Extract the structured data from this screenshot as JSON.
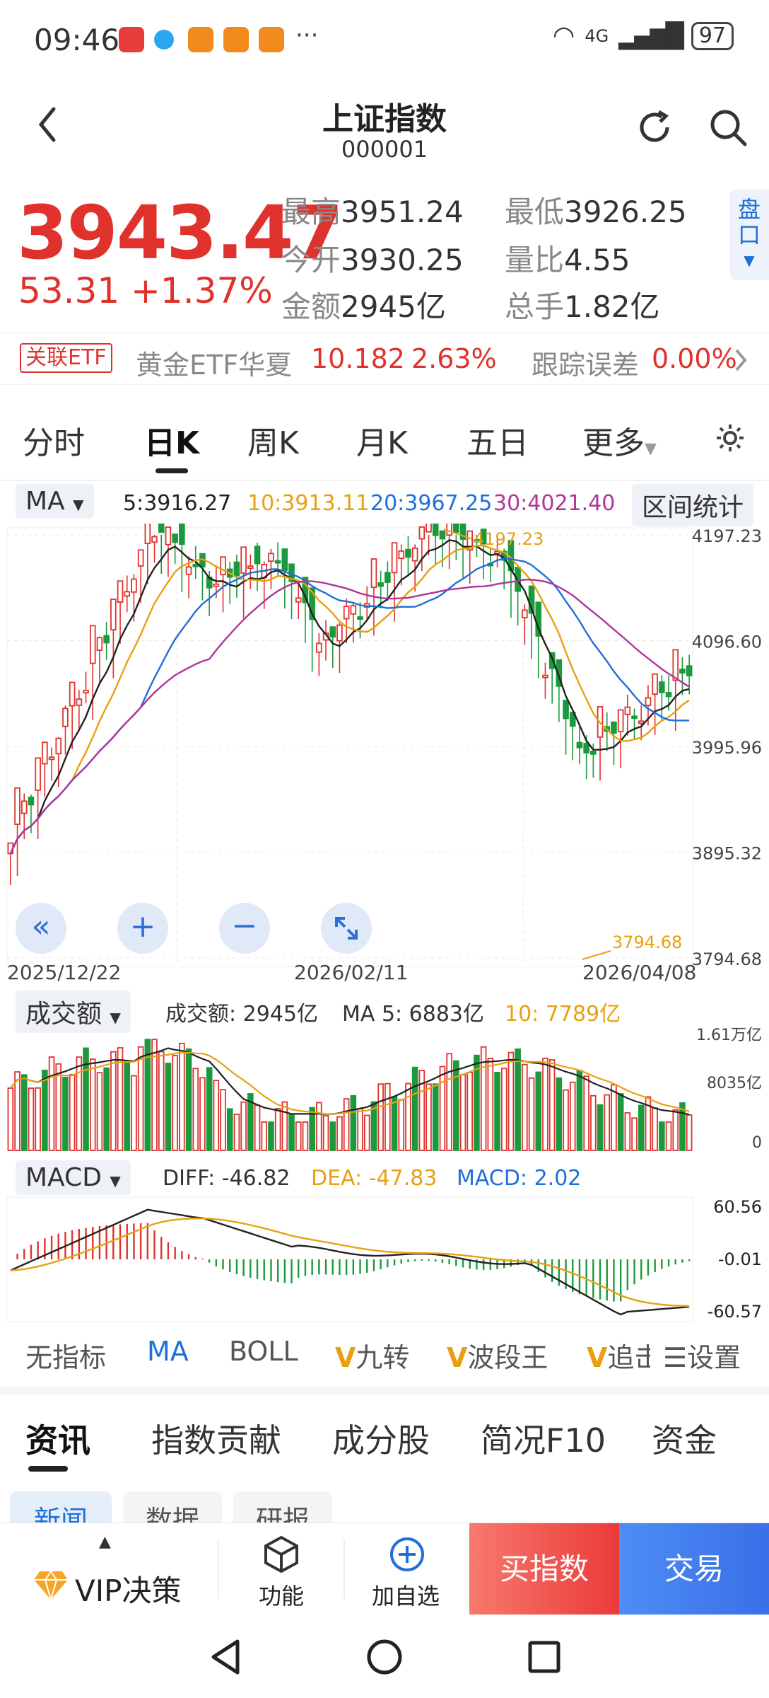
{
  "status_bar": {
    "time": "09:46",
    "ellipsis": "···",
    "network": "4G",
    "battery": "97"
  },
  "header": {
    "title": "上证指数",
    "code": "000001"
  },
  "quote": {
    "price": "3943.47",
    "change": "53.31 +1.37%",
    "high_label": "最高",
    "high": "3951.24",
    "low_label": "最低",
    "low": "3926.25",
    "open_label": "今开",
    "open": "3930.25",
    "ratio_label": "量比",
    "ratio": "4.55",
    "amount_label": "金额",
    "amount": "2945亿",
    "hands_label": "总手",
    "hands": "1.82亿",
    "pankou": "盘口"
  },
  "etf": {
    "tag": "关联ETF",
    "name": "黄金ETF华夏",
    "price": "10.182",
    "change": "2.63%",
    "error_label": "跟踪误差",
    "error": "0.00%"
  },
  "period_tabs": [
    "分时",
    "日K",
    "周K",
    "月K",
    "五日",
    "更多"
  ],
  "ma_row": {
    "selector": "MA",
    "ma5": "5:3916.27",
    "ma10": "10:3913.11",
    "ma20": "20:3967.25",
    "ma30": "30:4021.40",
    "range_stats": "区间统计"
  },
  "kline": {
    "y_ticks": [
      "4197.23",
      "4096.60",
      "3995.96",
      "3895.32",
      "3794.68"
    ],
    "high_marker": "4197.23",
    "low_marker": "3794.68",
    "dates": [
      "2025/12/22",
      "2026/02/11",
      "2026/04/08"
    ]
  },
  "volume": {
    "selector": "成交额",
    "value": "成交额: 2945亿",
    "ma5": "MA 5: 6883亿",
    "ma10": "10: 7789亿",
    "y_ticks": [
      "1.61万亿",
      "8035亿",
      "0"
    ]
  },
  "macd": {
    "selector": "MACD",
    "diff": "DIFF: -46.82",
    "dea": "DEA: -47.83",
    "macd": "MACD: 2.02",
    "y_ticks": [
      "60.56",
      "-0.01",
      "-60.57"
    ]
  },
  "indicator_tabs": [
    "无指标",
    "MA",
    "BOLL",
    "九转",
    "波段王",
    "追击",
    "设置"
  ],
  "news_tabs": [
    "资讯",
    "指数贡献",
    "成分股",
    "简况F10",
    "资金"
  ],
  "sub_tabs": [
    "新闻",
    "数据",
    "研报"
  ],
  "bottom_bar": {
    "vip": "VIP决策",
    "func": "功能",
    "add": "加自选",
    "buy": "买指数",
    "trade": "交易"
  },
  "colors": {
    "up": "#e0322d",
    "down": "#1a9a3c",
    "ma5": "#222222",
    "ma10": "#e8a012",
    "ma20": "#1f6fd8",
    "ma30": "#b0359a"
  }
}
